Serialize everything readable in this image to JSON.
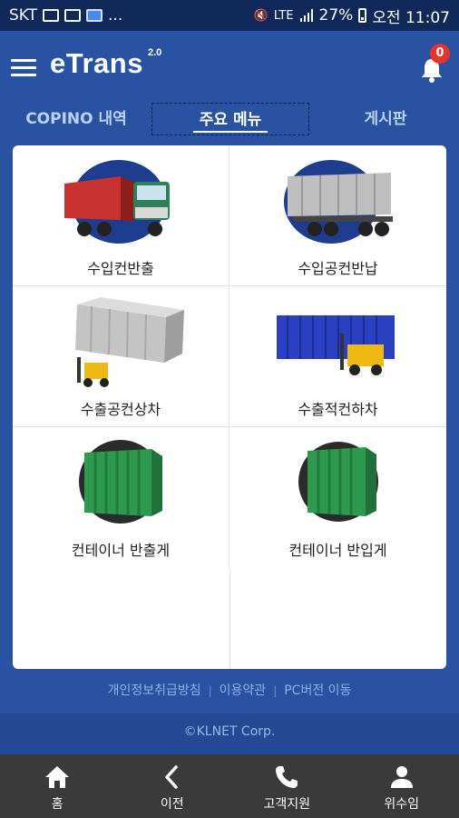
{
  "status_bar": {
    "carrier": "SKT",
    "ellipsis": "...",
    "battery": "27%",
    "time": "오전 11:07",
    "network": "LTE"
  },
  "header": {
    "logo": "eTrans",
    "logo_version": "2.0",
    "notification_count": "0"
  },
  "tabs": [
    {
      "label": "COPINO 내역",
      "active": false
    },
    {
      "label": "주요 메뉴",
      "active": true
    },
    {
      "label": "게시판",
      "active": false
    }
  ],
  "menu": [
    {
      "label": "수입컨반출",
      "icon": "truck-red-container-icon"
    },
    {
      "label": "수입공컨반납",
      "icon": "truck-gray-container-icon"
    },
    {
      "label": "수출공컨상차",
      "icon": "forklift-gray-container-icon"
    },
    {
      "label": "수출적컨하차",
      "icon": "forklift-blue-container-icon"
    },
    {
      "label": "컨테이너 반출게",
      "icon": "green-container-icon"
    },
    {
      "label": "컨테이너 반입게",
      "icon": "green-container-icon"
    }
  ],
  "footer": {
    "links": [
      "개인정보취급방침",
      "이용약관",
      "PC버전 이동"
    ],
    "copyright": "©KLNET Corp."
  },
  "bottom_nav": [
    {
      "label": "홈",
      "icon": "home-icon"
    },
    {
      "label": "이전",
      "icon": "back-chevron-icon"
    },
    {
      "label": "고객지원",
      "icon": "phone-icon"
    },
    {
      "label": "위수임",
      "icon": "person-icon"
    }
  ],
  "colors": {
    "primary": "#2a52a3",
    "status_bar": "#11285a",
    "bottom_nav": "#3a3a3a",
    "badge": "#e8322c"
  }
}
